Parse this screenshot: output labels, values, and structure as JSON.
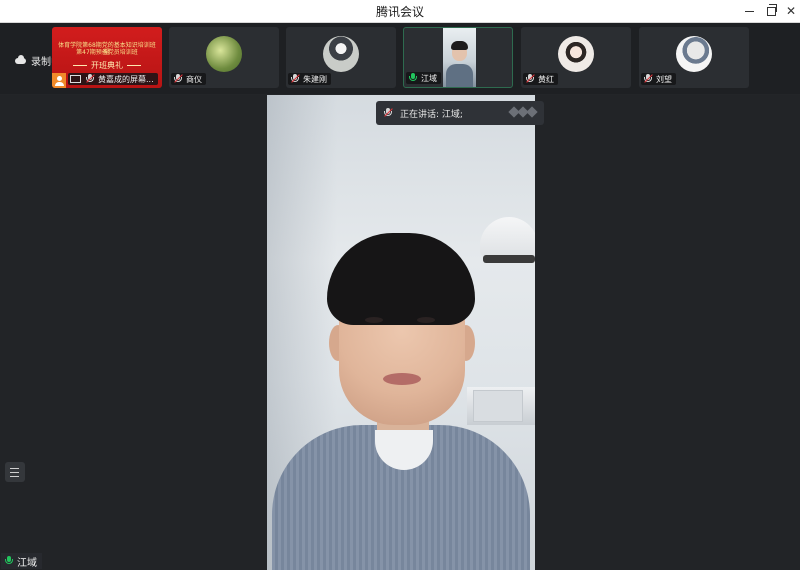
{
  "window": {
    "title": "腾讯会议"
  },
  "recording": {
    "label": "录制中"
  },
  "share_tile": {
    "line1": "体育学院第68期党的基本知识培训班暨",
    "line2": "第47期预备党员培训班",
    "line3": "开班典礼",
    "name": "黄嘉成的屏幕..."
  },
  "participants": [
    {
      "name": "商仪",
      "mic": "muted"
    },
    {
      "name": "朱建刚",
      "mic": "muted"
    },
    {
      "name": "江域",
      "mic": "on"
    },
    {
      "name": "黄红",
      "mic": "muted"
    },
    {
      "name": "刘望",
      "mic": "muted"
    }
  ],
  "speaking": {
    "label": "正在讲话: 江域;"
  },
  "stage": {
    "speaker_name": "江域"
  }
}
